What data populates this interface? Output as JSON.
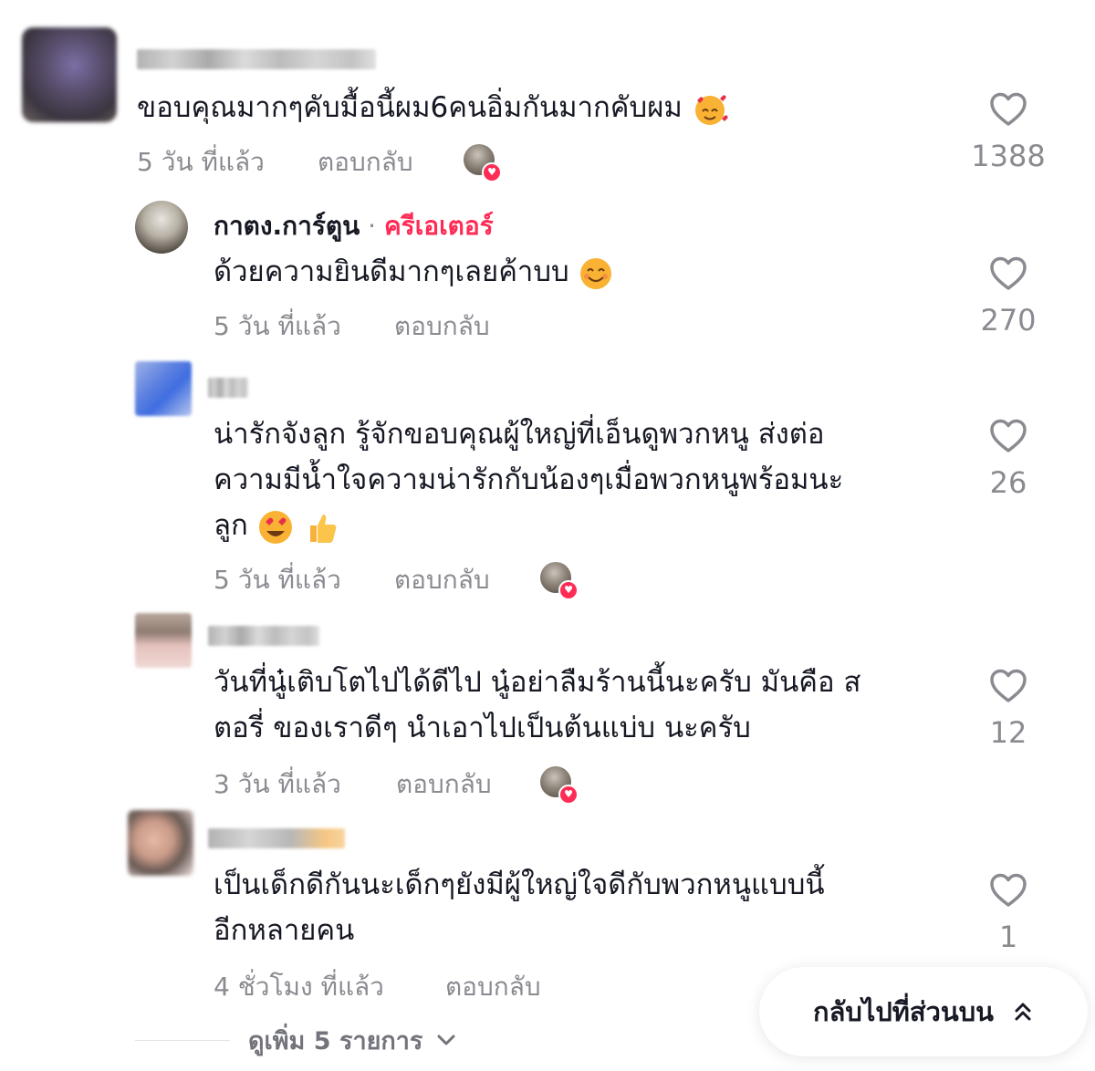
{
  "comments": [
    {
      "text": "ขอบคุณมากๆคับมื้อนี้ผม6คนอิ่มกันมากคับผม",
      "emoji": "smiling-face-with-hearts",
      "time": "5 วัน ที่แล้ว",
      "reply": "ตอบกลับ",
      "likes": "1388"
    },
    {
      "author": "กาตง.การ์ตูน",
      "separator": "·",
      "badge": "ครีเอเตอร์",
      "text": "ด้วยความยินดีมากๆเลยค้าบบ",
      "emoji": "smiling-face",
      "time": "5 วัน ที่แล้ว",
      "reply": "ตอบกลับ",
      "likes": "270"
    },
    {
      "text_line1": "น่ารักจังลูก รู้จักขอบคุณผู้ใหญ่ที่เอ็นดูพวกหนู ส่งต่อ",
      "text_line2": "ความมีน้ำใจความน่ารักกับน้องๆเมื่อพวกหนูพร้อมนะ",
      "text_line3": "ลูก",
      "emoji": [
        "heart-eyes",
        "thumbs-up"
      ],
      "time": "5 วัน ที่แล้ว",
      "reply": "ตอบกลับ",
      "likes": "26"
    },
    {
      "text_line1": "วันที่นู๋เติบโตไปได้ดีไป นู๋อย่าลืมร้านนี้นะครับ มันคือ ส",
      "text_line2": "ตอรี่ ของเราดีๆ นำเอาไปเป็นต้นแบ่บ นะครับ",
      "time": "3 วัน ที่แล้ว",
      "reply": "ตอบกลับ",
      "likes": "12"
    },
    {
      "text_line1": "เป็นเด็กดีกันนะเด็กๆยังมีผู้ใหญ่ใจดีกับพวกหนูแบบนี้",
      "text_line2": "อีกหลายคน",
      "time": "4 ชั่วโมง ที่แล้ว",
      "reply": "ตอบกลับ",
      "likes": "1"
    }
  ],
  "view_more": "ดูเพิ่ม 5 รายการ",
  "back_to_top": "กลับไปที่ส่วนบน",
  "colors": {
    "accent": "#fe2c55",
    "meta": "#8a8b91",
    "text": "#161823"
  },
  "icons": [
    "heart-outline-icon",
    "chevron-down-icon",
    "double-chevron-up-icon"
  ]
}
